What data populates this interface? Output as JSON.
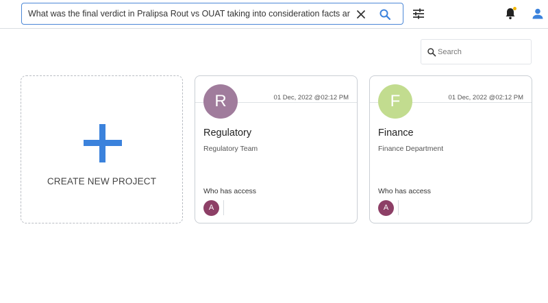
{
  "header": {
    "search_query": "What was the final verdict in Pralipsa Rout vs OUAT taking into consideration facts and circu"
  },
  "project_search": {
    "placeholder": "Search"
  },
  "create_card": {
    "label": "CREATE NEW PROJECT"
  },
  "projects": [
    {
      "initial": "R",
      "avatar_color": "#a07c9c",
      "date": "01 Dec, 2022 @02:12 PM",
      "title": "Regulatory",
      "subtitle": "Regulatory Team",
      "access_label": "Who has access",
      "member_initial": "A"
    },
    {
      "initial": "F",
      "avatar_color": "#c2dc8f",
      "date": "01 Dec, 2022 @02:12 PM",
      "title": "Finance",
      "subtitle": "Finance Department",
      "access_label": "Who has access",
      "member_initial": "A"
    }
  ],
  "colors": {
    "accent": "#3b82dc",
    "member_avatar": "#8d3f66",
    "notification_dot": "#f2b705"
  }
}
